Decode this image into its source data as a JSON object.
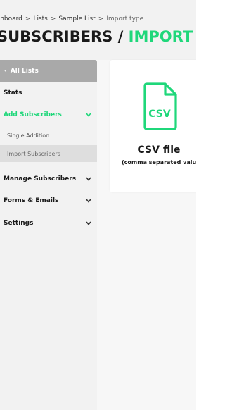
{
  "breadcrumb": {
    "items": [
      "ashboard",
      "Lists",
      "Sample List",
      "Import type"
    ],
    "separator": ">"
  },
  "page_title": {
    "part1": "SUBSCRIBERS /",
    "part2": "IMPORT TYPE"
  },
  "sidebar": {
    "back_label": "All Lists",
    "items": [
      {
        "label": "Stats"
      },
      {
        "label": "Add Subscribers",
        "expanded": true
      },
      {
        "label": "Single Addition"
      },
      {
        "label": "Import Subscribers",
        "selected": true
      },
      {
        "label": "Manage Subscribers"
      },
      {
        "label": "Forms & Emails"
      },
      {
        "label": "Settings"
      }
    ]
  },
  "import_options": [
    {
      "icon": "csv-file-icon",
      "icon_text": "CSV",
      "title": "CSV file",
      "subtitle": "(comma separated valu"
    }
  ],
  "colors": {
    "accent": "#1fd77a",
    "back_button_bg": "#a9a9a9",
    "selected_item_bg": "#dedede",
    "background": "#f2f2f2"
  }
}
